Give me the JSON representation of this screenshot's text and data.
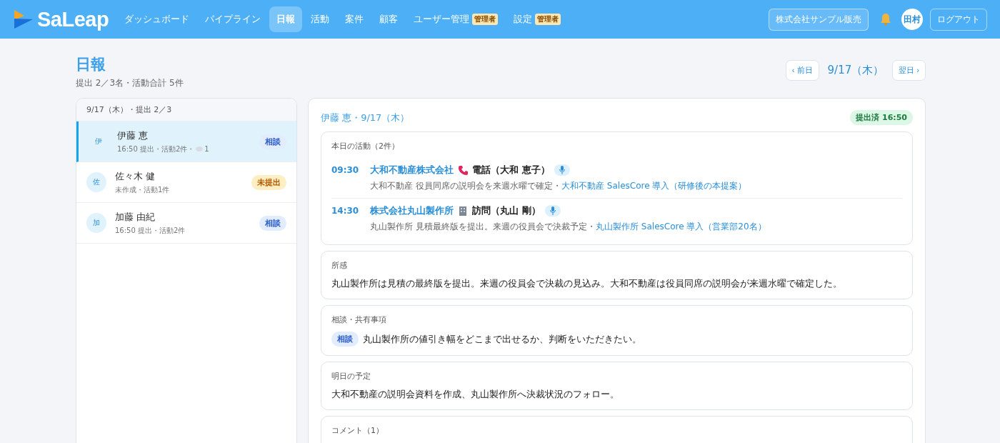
{
  "header": {
    "logo": "SaLeap",
    "nav": [
      {
        "label": "ダッシュボード",
        "selected": false
      },
      {
        "label": "パイプライン",
        "selected": false
      },
      {
        "label": "日報",
        "selected": true
      },
      {
        "label": "活動",
        "selected": false
      },
      {
        "label": "案件",
        "selected": false
      },
      {
        "label": "顧客",
        "selected": false
      },
      {
        "label": "ユーザー管理",
        "selected": false,
        "badge": "管理者"
      },
      {
        "label": "設定",
        "selected": false,
        "badge": "管理者"
      }
    ],
    "company": "株式会社サンプル販売",
    "user": "田村",
    "logout": "ログアウト"
  },
  "page": {
    "title": "日報",
    "summary": "提出 2／3名・活動合計 5件",
    "prev": "‹ 前日",
    "date": "9/17（木）",
    "next": "翌日 ›"
  },
  "members": {
    "header": "9/17（木）・提出 2／3",
    "items": [
      {
        "initial": "伊",
        "name": "伊藤 恵",
        "meta": "16:50 提出・活動2件・",
        "comments": "1",
        "badge": "相談",
        "kind": "consult",
        "selected": true
      },
      {
        "initial": "佐",
        "name": "佐々木 健",
        "meta": "未作成・活動1件",
        "badge": "未提出",
        "kind": "pending",
        "selected": false
      },
      {
        "initial": "加",
        "name": "加藤 由紀",
        "meta": "16:50 提出・活動2件",
        "badge": "相談",
        "kind": "consult",
        "selected": false
      }
    ]
  },
  "report": {
    "title": "伊藤 恵・9/17（木）",
    "status": "提出済 16:50",
    "activities_title": "本日の活動（2件）",
    "activities": [
      {
        "time": "09:30",
        "company": "大和不動産株式会社",
        "kind": "phone",
        "label": "電話（大和 恵子）",
        "note": "大和不動産 役員同席の説明会を来週水曜で確定・",
        "deal": "大和不動産 SalesCore 導入（研修後の本提案）"
      },
      {
        "time": "14:30",
        "company": "株式会社丸山製作所",
        "kind": "visit",
        "label": "訪問（丸山 剛）",
        "note": "丸山製作所 見積最終版を提出。来週の役員会で決裁予定・",
        "deal": "丸山製作所 SalesCore 導入（営業部20名）"
      }
    ],
    "sections": [
      {
        "title": "所感",
        "text": "丸山製作所は見積の最終版を提出。来週の役員会で決裁の見込み。大和不動産は役員同席の説明会が来週水曜で確定した。"
      },
      {
        "title": "相談・共有事項",
        "tag": "相談",
        "text": "丸山製作所の値引き幅をどこまで出せるか、判断をいただきたい。"
      },
      {
        "title": "明日の予定",
        "text": "大和不動産の説明会資料を作成、丸山製作所へ決裁状況のフォロー。"
      },
      {
        "title": "コメント（1）"
      }
    ]
  }
}
